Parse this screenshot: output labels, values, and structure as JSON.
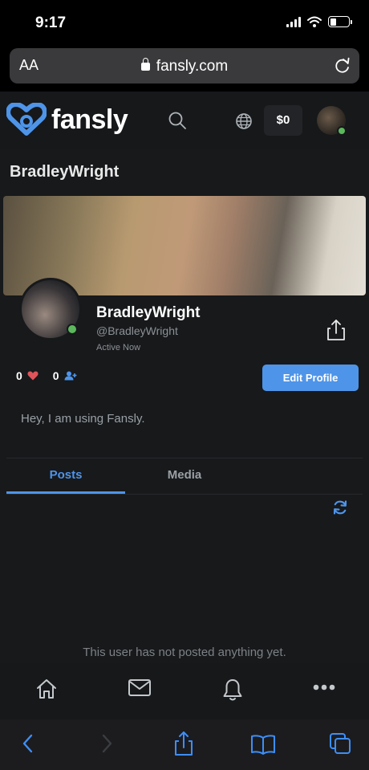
{
  "status_bar": {
    "time": "9:17"
  },
  "browser": {
    "aa_label": "AA",
    "url": "fansly.com"
  },
  "header": {
    "logo_text": "fansly",
    "balance": "$0"
  },
  "profile": {
    "page_title": "BradleyWright",
    "display_name": "BradleyWright",
    "username": "@BradleyWright",
    "active_status": "Active Now",
    "likes_count": "0",
    "followers_count": "0",
    "edit_button": "Edit Profile",
    "bio": "Hey, I am using Fansly."
  },
  "tabs": [
    {
      "label": "Posts",
      "active": true
    },
    {
      "label": "Media",
      "active": false
    }
  ],
  "empty_message": "This user has not posted anything yet.",
  "colors": {
    "accent": "#4e94e9",
    "online": "#5cb85c",
    "heart": "#e0535a",
    "background": "#17191b"
  }
}
